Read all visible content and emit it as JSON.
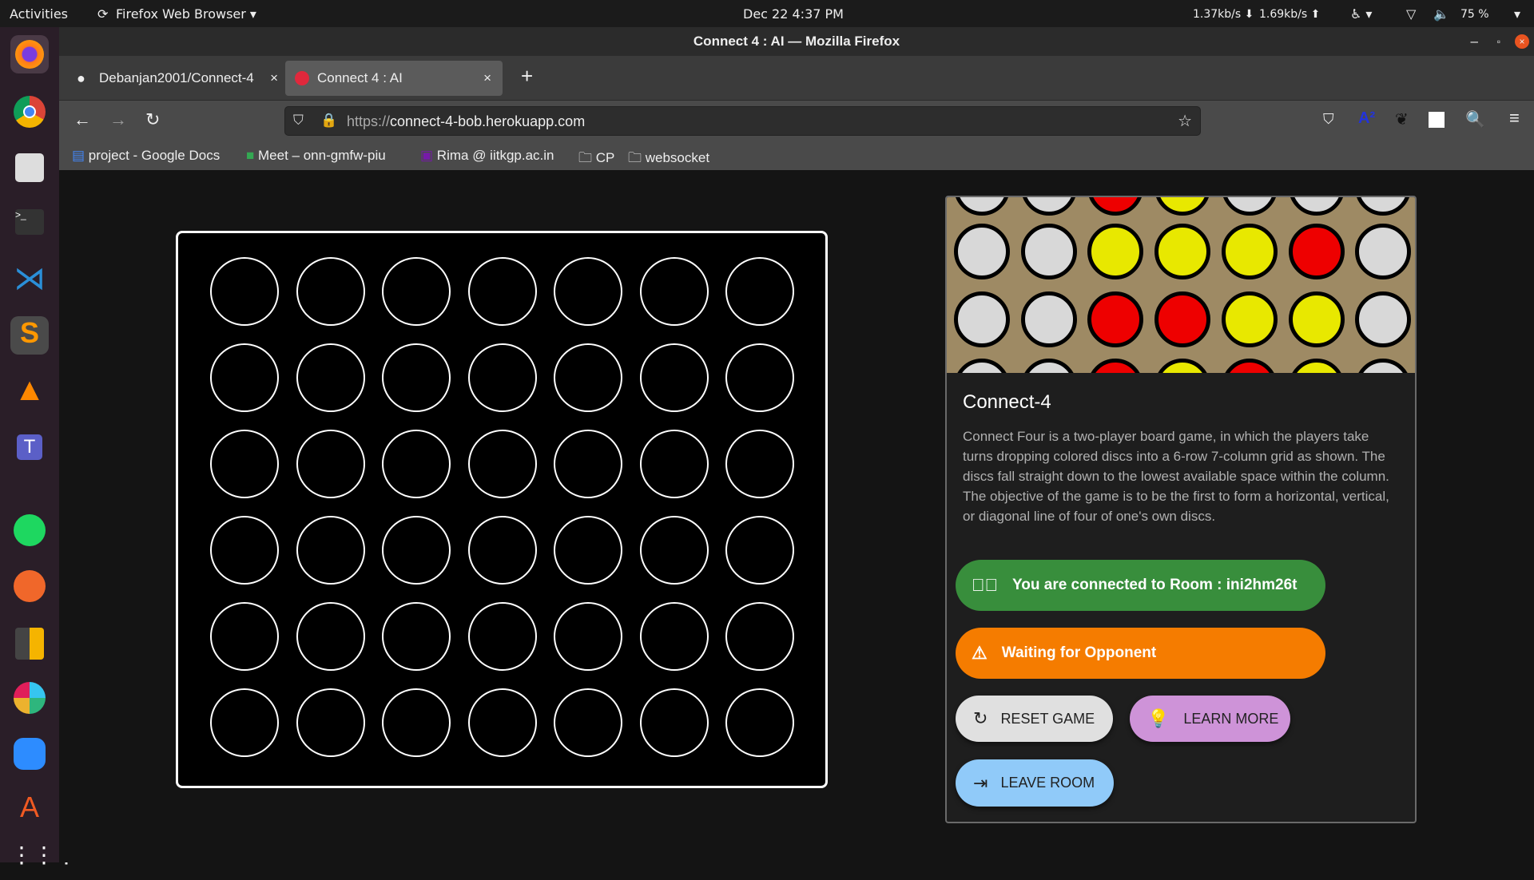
{
  "system_bar": {
    "activities": "Activities",
    "app_menu": "Firefox Web Browser ▾",
    "clock": "Dec 22   4:37 PM",
    "net_down": "1.37kb/s ⬇",
    "net_up": "1.69kb/s ⬆",
    "battery": "75 %"
  },
  "window": {
    "title": "Connect 4 : AI — Mozilla Firefox"
  },
  "tabs": [
    {
      "label": "Debanjan2001/Connect-4",
      "active": false
    },
    {
      "label": "Connect 4 : AI",
      "active": true
    }
  ],
  "url": {
    "scheme": "https://",
    "host": "connect-4-bob.herokuapp.com"
  },
  "bookmarks": [
    {
      "label": "project - Google Docs"
    },
    {
      "label": "Meet – onn-gmfw-piu"
    },
    {
      "label": "Rima @ iitkgp.ac.in"
    },
    {
      "label": "CP"
    },
    {
      "label": "websocket"
    }
  ],
  "game": {
    "rows": 6,
    "columns": 7,
    "cells": "empty"
  },
  "preview": {
    "rows": [
      [
        "W",
        "W",
        "R",
        "Y",
        "W",
        "W",
        "W"
      ],
      [
        "W",
        "W",
        "Y",
        "Y",
        "Y",
        "R",
        "W"
      ],
      [
        "W",
        "W",
        "R",
        "R",
        "Y",
        "Y",
        "W"
      ],
      [
        "W",
        "W",
        "R",
        "Y",
        "R",
        "Y",
        "W"
      ]
    ],
    "colors": {
      "W": "#d8d8d8",
      "R": "#ee0000",
      "Y": "#e8e800",
      "board": "#9e8a64"
    }
  },
  "card": {
    "title": "Connect-4",
    "description": "Connect Four is a two-player board game, in which the players take turns dropping colored discs into a 6-row 7-column grid as shown. The discs fall straight down to the lowest available space within the column. The objective of the game is to be the first to form a horizontal, vertical, or diagonal line of four of one's own discs."
  },
  "status": {
    "connected": "You are connected to Room : ini2hm26t",
    "waiting": "Waiting for Opponent",
    "connected_color": "#388e3c",
    "waiting_color": "#f57c00"
  },
  "buttons": {
    "reset": "RESET GAME",
    "learn": "LEARN MORE",
    "leave": "LEAVE ROOM"
  }
}
